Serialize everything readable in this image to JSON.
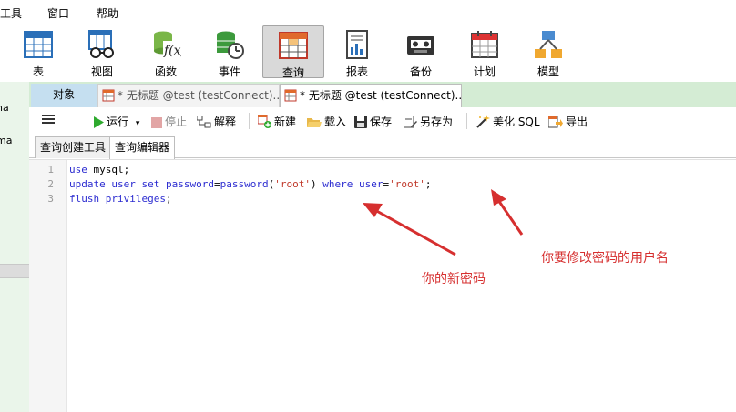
{
  "menu": [
    "工具",
    "窗口",
    "帮助"
  ],
  "ribbon": [
    {
      "key": "table",
      "label": "表",
      "icon": "table-icon"
    },
    {
      "key": "view",
      "label": "视图",
      "icon": "view-icon"
    },
    {
      "key": "function",
      "label": "函数",
      "icon": "function-icon"
    },
    {
      "key": "event",
      "label": "事件",
      "icon": "event-icon"
    },
    {
      "key": "query",
      "label": "查询",
      "icon": "query-icon",
      "active": true
    },
    {
      "key": "report",
      "label": "报表",
      "icon": "report-icon"
    },
    {
      "key": "backup",
      "label": "备份",
      "icon": "backup-icon"
    },
    {
      "key": "schedule",
      "label": "计划",
      "icon": "schedule-icon"
    },
    {
      "key": "model",
      "label": "模型",
      "icon": "model-icon"
    }
  ],
  "left_panel": {
    "items": [
      "na",
      "ma"
    ]
  },
  "tabs": {
    "objects": "对象",
    "query1": "* 无标题 @test (testConnect)...",
    "query2": "* 无标题 @test (testConnect)..."
  },
  "toolbar": {
    "run": "运行",
    "stop": "停止",
    "explain": "解释",
    "new": "新建",
    "load": "载入",
    "save": "保存",
    "save_as": "另存为",
    "beautify": "美化 SQL",
    "export": "导出"
  },
  "subtabs": {
    "builder": "查询创建工具",
    "editor": "查询编辑器"
  },
  "editor": {
    "line_numbers": [
      "1",
      "2",
      "3"
    ],
    "line1": {
      "kw": "use",
      "rest": " mysql;"
    },
    "line2": {
      "kw1": "update",
      "t1": " ",
      "kw2": "user",
      "t2": " ",
      "kw3": "set",
      "t3": " ",
      "kw4": "password",
      "t4": "=",
      "kw5": "password",
      "t5": "(",
      "s1": "'root'",
      "t6": ") ",
      "kw6": "where",
      "t7": " ",
      "kw7": "user",
      "t8": "=",
      "s2": "'root'",
      "t9": ";"
    },
    "line3": {
      "kw1": "flush",
      "t1": " ",
      "kw2": "privileges",
      "t2": ";"
    }
  },
  "annotations": {
    "new_password": "你的新密码",
    "target_user": "你要修改密码的用户名",
    "color": "#d62f2f"
  },
  "colors": {
    "accent_green": "#d4ecd4",
    "run_green": "#2eaa2e",
    "keyword_blue": "#2b2bd0",
    "string_red": "#c0392b"
  }
}
